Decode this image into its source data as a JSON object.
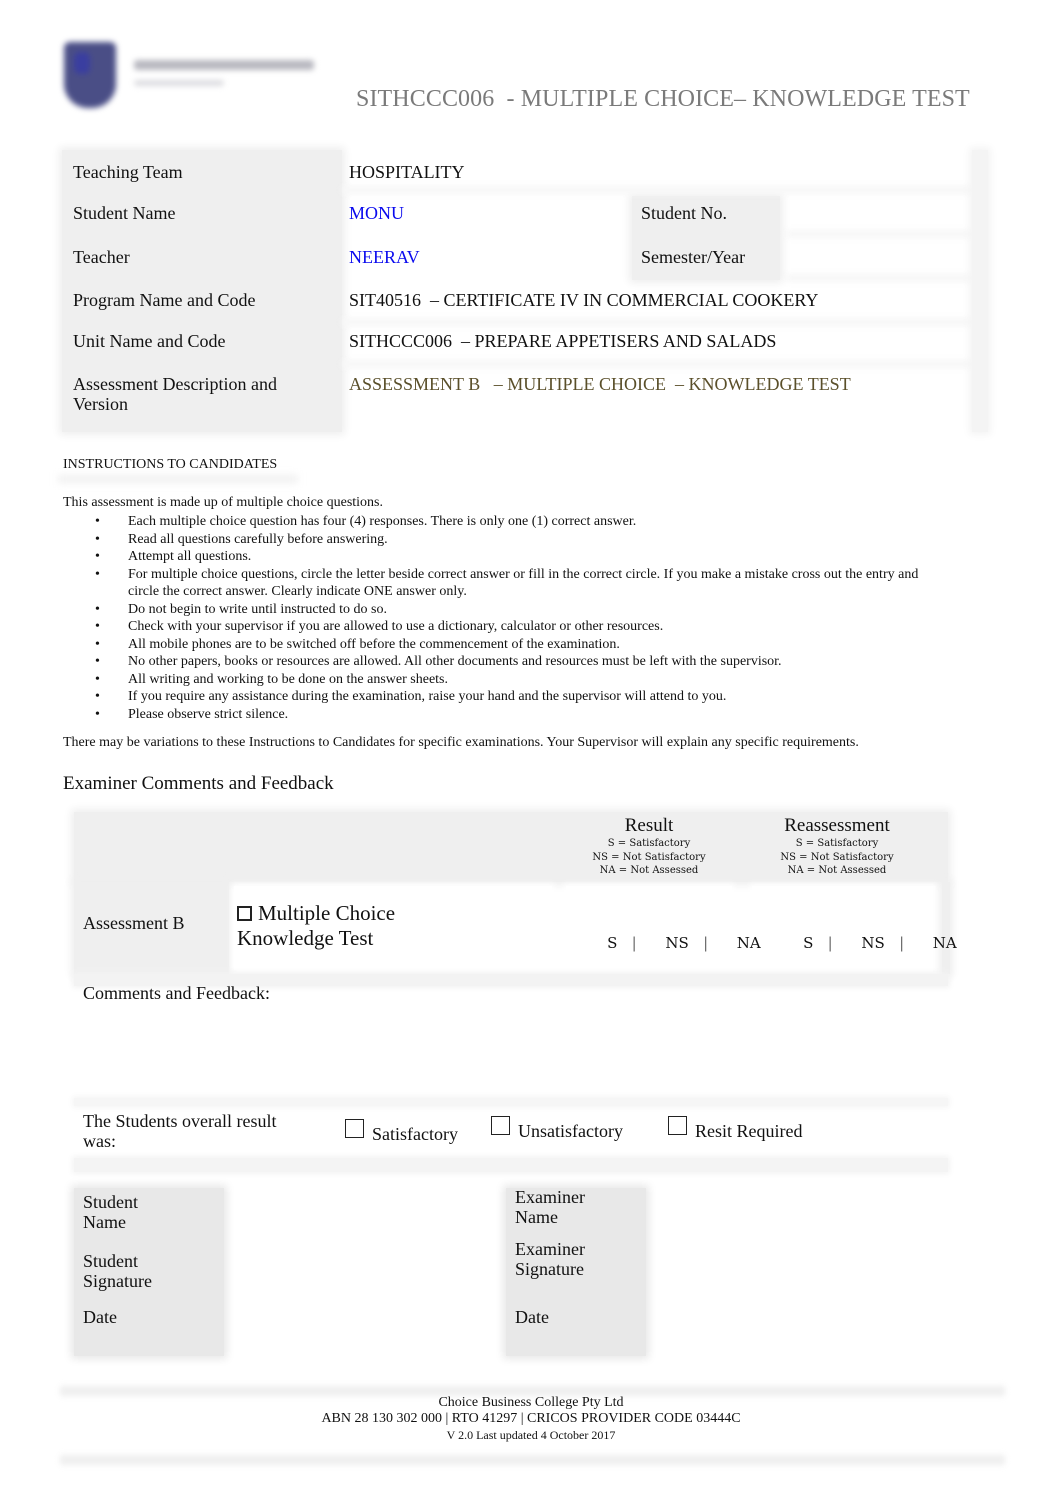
{
  "header": {
    "logo": "college-logo",
    "title": "SITHCCC006  - MULTIPLE CHOICE– KNOWLEDGE TEST"
  },
  "info": {
    "teaching_team": {
      "label": "Teaching Team",
      "value": "HOSPITALITY"
    },
    "student_name": {
      "label": "Student Name",
      "value": "MONU"
    },
    "student_no": {
      "label": "Student No.",
      "value": ""
    },
    "teacher": {
      "label": "Teacher",
      "value": "NEERAV"
    },
    "semester_year": {
      "label": "Semester/Year",
      "value": ""
    },
    "program": {
      "label": "Program Name and Code",
      "value": "SIT40516  – CERTIFICATE IV IN COMMERCIAL COOKERY"
    },
    "unit": {
      "label": "Unit Name and Code",
      "value": "SITHCCC006  – PREPARE APPETISERS AND SALADS"
    },
    "assessment": {
      "label_line1": "Assessment Description and",
      "label_line2": "Version",
      "value": "ASSESSMENT B   – MULTIPLE CHOICE  – KNOWLEDGE TEST"
    },
    "colors": {
      "filled_value": "#0a0aee",
      "assessment_value": "#5a4f2a"
    }
  },
  "instructions": {
    "heading": "INSTRUCTIONS TO CANDIDATES",
    "intro": "This assessment is made up of multiple choice questions.",
    "bullet_glyph": "•",
    "items": [
      "Each multiple choice question has four (4) responses. There is only one (1) correct answer.",
      "Read all questions carefully before answering.",
      "Attempt all questions.",
      "For multiple choice questions, circle the letter beside correct answer or fill in the correct circle. If you make a mistake cross out the entry and circle the correct answer. Clearly indicate ONE answer only.",
      "Do not begin to write until instructed to do so.",
      "Check with your supervisor if you are allowed to use a dictionary, calculator or other resources.",
      "All mobile phones are to be switched off before the commencement of the examination.",
      "No other papers, books or resources are allowed. All other documents and resources must be left with the supervisor.",
      "All writing and working to be done on the answer sheets.",
      "If you require any assistance during the examination, raise your hand and the supervisor will attend to you.",
      "Please observe strict silence."
    ],
    "variations": "There may be variations to these Instructions to Candidates for specific examinations. Your Supervisor will explain any specific requirements."
  },
  "feedback": {
    "title": "Examiner Comments and Feedback",
    "result": {
      "heading": "Result",
      "legend": [
        "S = Satisfactory",
        "NS = Not Satisfactory",
        "NA = Not Assessed"
      ]
    },
    "reassessment": {
      "heading": "Reassessment",
      "legend": [
        "S = Satisfactory",
        "NS = Not Satisfactory",
        "NA = Not Assessed"
      ]
    },
    "assessment_label": "Assessment B",
    "mc_line1": "Multiple Choice",
    "mc_line2": "Knowledge Test",
    "options": {
      "s": "S",
      "ns": "NS",
      "na": "NA",
      "sep": "|"
    },
    "comments_label": "Comments and Feedback:",
    "comments_value": "",
    "overall_label_line1": "The Students overall result",
    "overall_label_line2": "was:",
    "overall_options": [
      "Satisfactory",
      "Unsatisfactory",
      "Resit Required"
    ]
  },
  "signatures": {
    "student_name": {
      "line1": "Student",
      "line2": "Name"
    },
    "student_signature": {
      "line1": "Student",
      "line2": "Signature"
    },
    "student_date": "Date",
    "examiner_name": {
      "line1": "Examiner",
      "line2": "Name"
    },
    "examiner_signature": {
      "line1": "Examiner",
      "line2": "Signature"
    },
    "examiner_date": "Date"
  },
  "footer": {
    "company": "Choice Business College Pty Ltd",
    "registration": "ABN 28 130 302 000 | RTO 41297 | CRICOS PROVIDER CODE 03444C",
    "version": "V 2.0 Last updated 4 October 2017"
  }
}
